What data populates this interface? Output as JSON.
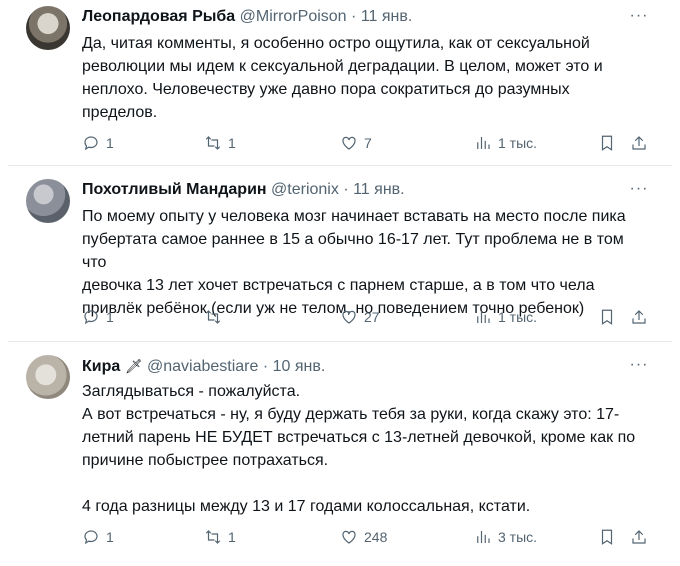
{
  "tweets": [
    {
      "name": "Леопардовая Рыба",
      "handle": "@MirrorPoison",
      "date": "11 янв.",
      "lines": [
        "Да, читая комменты, я особенно остро ощутила, как от сексуальной",
        "революции мы идем к сексуальной деградации. В целом, может это и",
        "неплохо. Человечеству уже давно пора сократиться до разумных",
        "пределов."
      ],
      "replies": "1",
      "retweets": "1",
      "likes": "7",
      "views": "1 тыс."
    },
    {
      "name": "Похотливый Мандарин",
      "handle": "@terionix",
      "date": "11 янв.",
      "lines": [
        "По моему опыту у человека мозг начинает вставать на место после пика",
        "пубертата самое раннее в 15 а обычно 16-17 лет. Тут проблема не в том что",
        "девочка 13 лет хочет встречаться с парнем старше, а в том что чела",
        "привлёк ребёнок (если уж не телом, но поведением точно ребенок)"
      ],
      "replies": "1",
      "retweets": "",
      "likes": "27",
      "views": "1 тыс."
    },
    {
      "name": "Кира",
      "name_emoji": "🗡",
      "handle": "@naviabestiare",
      "date": "10 янв.",
      "lines": [
        "Заглядываться - пожалуйста.",
        "А вот встречаться - ну, я буду держать тебя за руки, когда скажу это:  17-",
        "летний парень НЕ БУДЕТ встречаться с 13-летней девочкой, кроме как по",
        "причине побыстрее потрахаться.",
        "",
        "4 года разницы между 13 и 17 годами колоссальная, кстати."
      ],
      "replies": "1",
      "retweets": "1",
      "likes": "248",
      "views": "3 тыс."
    }
  ],
  "separator": "·",
  "more_label": "···",
  "icons": [
    "reply-icon",
    "retweet-icon",
    "like-icon",
    "views-icon",
    "bookmark-icon",
    "share-icon"
  ],
  "colors": {
    "text": "#0f1419",
    "muted": "#536471",
    "divider": "#e6e9ec"
  }
}
